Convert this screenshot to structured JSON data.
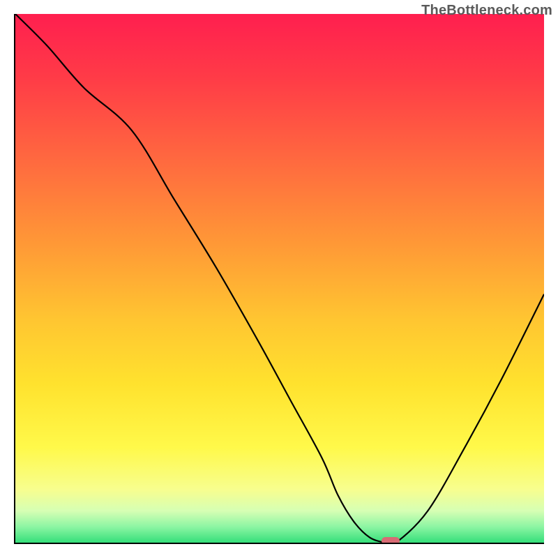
{
  "watermark": "TheBottleneck.com",
  "chart_data": {
    "type": "line",
    "title": "",
    "xlabel": "",
    "ylabel": "",
    "xlim": [
      0,
      100
    ],
    "ylim": [
      0,
      100
    ],
    "grid": false,
    "series": [
      {
        "name": "bottleneck-curve",
        "x": [
          0,
          6,
          13,
          22,
          30,
          38,
          46,
          52,
          58,
          61,
          64,
          67,
          70,
          72,
          78,
          85,
          92,
          100
        ],
        "y": [
          100,
          94,
          86,
          78,
          65,
          52,
          38,
          27,
          16,
          9,
          4,
          1,
          0,
          0,
          6,
          18,
          31,
          47
        ]
      }
    ],
    "background_gradient": {
      "stops": [
        {
          "pct": 0,
          "color": "#ff1f4f"
        },
        {
          "pct": 12,
          "color": "#ff3b47"
        },
        {
          "pct": 28,
          "color": "#ff6a3f"
        },
        {
          "pct": 44,
          "color": "#ff9a36"
        },
        {
          "pct": 58,
          "color": "#ffc631"
        },
        {
          "pct": 70,
          "color": "#ffe22e"
        },
        {
          "pct": 82,
          "color": "#fff94a"
        },
        {
          "pct": 90,
          "color": "#f7fe8f"
        },
        {
          "pct": 94,
          "color": "#d6ffb4"
        },
        {
          "pct": 97,
          "color": "#8cf5a3"
        },
        {
          "pct": 100,
          "color": "#35df7a"
        }
      ]
    },
    "min_marker": {
      "x": 71,
      "y": 0,
      "color": "#d86b74"
    }
  }
}
